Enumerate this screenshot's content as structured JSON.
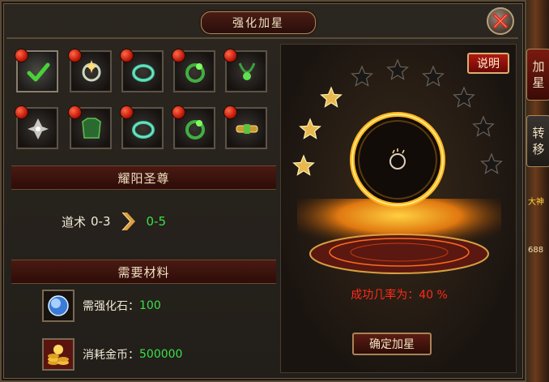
{
  "window": {
    "title": "强化加星"
  },
  "item_grid": {
    "slots": [
      {
        "icon": "selected-check",
        "selected": true
      },
      {
        "icon": "sparkle-bracelet"
      },
      {
        "icon": "jade-bracelet"
      },
      {
        "icon": "green-ring"
      },
      {
        "icon": "green-necklace"
      },
      {
        "icon": "silver-amulet"
      },
      {
        "icon": "green-armor"
      },
      {
        "icon": "jade-bracelet"
      },
      {
        "icon": "green-ring"
      },
      {
        "icon": "gold-belt"
      }
    ]
  },
  "equipment": {
    "name": "耀阳圣尊"
  },
  "stat": {
    "label": "道术",
    "from": "0-3",
    "to": "0-5"
  },
  "materials": {
    "header": "需要材料",
    "stone_label": "需强化石：",
    "stone_value": "100",
    "gold_label": "消耗金币：",
    "gold_value": "500000"
  },
  "star_panel": {
    "help_label": "说明",
    "lit_stars": 3,
    "total_stars": 10,
    "success_rate": "成功几率为：40 %",
    "confirm_label": "确定加星"
  },
  "side_tabs": [
    {
      "label_top": "加",
      "label_bottom": "星",
      "active": true
    },
    {
      "label_top": "转",
      "label_bottom": "移",
      "active": false
    }
  ],
  "edge_fragments": {
    "name_text": "大神",
    "number_text": "688"
  },
  "colors": {
    "accent_green": "#39e04a",
    "rate_red": "#ff2a1a",
    "gold": "#d8b070"
  }
}
